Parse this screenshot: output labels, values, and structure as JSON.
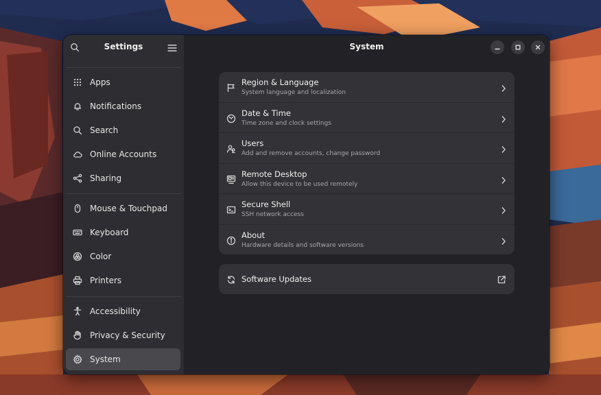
{
  "colors": {
    "window_bg": "#222226",
    "sidebar_bg": "#2e2e32",
    "card_bg": "#333337",
    "active_item_bg": "#48484d"
  },
  "sidebar": {
    "title": "Settings",
    "search_icon": "search-icon",
    "menu_icon": "hamburger-menu-icon",
    "groups": [
      [
        {
          "label": "Apps",
          "icon": "apps-grid-icon"
        },
        {
          "label": "Notifications",
          "icon": "bell-icon"
        },
        {
          "label": "Search",
          "icon": "search-icon"
        },
        {
          "label": "Online Accounts",
          "icon": "cloud-icon"
        },
        {
          "label": "Sharing",
          "icon": "share-icon"
        }
      ],
      [
        {
          "label": "Mouse & Touchpad",
          "icon": "mouse-icon"
        },
        {
          "label": "Keyboard",
          "icon": "keyboard-icon"
        },
        {
          "label": "Color",
          "icon": "color-icon"
        },
        {
          "label": "Printers",
          "icon": "printer-icon"
        }
      ],
      [
        {
          "label": "Accessibility",
          "icon": "accessibility-icon"
        },
        {
          "label": "Privacy & Security",
          "icon": "hand-icon"
        },
        {
          "label": "System",
          "icon": "gear-icon",
          "active": true
        }
      ]
    ]
  },
  "content": {
    "title": "System",
    "window_controls": [
      "minimize-icon",
      "maximize-icon",
      "close-icon"
    ],
    "rows": [
      {
        "title": "Region & Language",
        "subtitle": "System language and localization",
        "icon": "flag-icon"
      },
      {
        "title": "Date & Time",
        "subtitle": "Time zone and clock settings",
        "icon": "clock-icon"
      },
      {
        "title": "Users",
        "subtitle": "Add and remove accounts, change password",
        "icon": "users-icon"
      },
      {
        "title": "Remote Desktop",
        "subtitle": "Allow this device to be used remotely",
        "icon": "remote-desktop-icon"
      },
      {
        "title": "Secure Shell",
        "subtitle": "SSH network access",
        "icon": "terminal-icon"
      },
      {
        "title": "About",
        "subtitle": "Hardware details and software versions",
        "icon": "info-icon"
      }
    ],
    "software_updates": {
      "title": "Software Updates",
      "icon": "refresh-icon",
      "trailing_icon": "external-link-icon"
    }
  }
}
